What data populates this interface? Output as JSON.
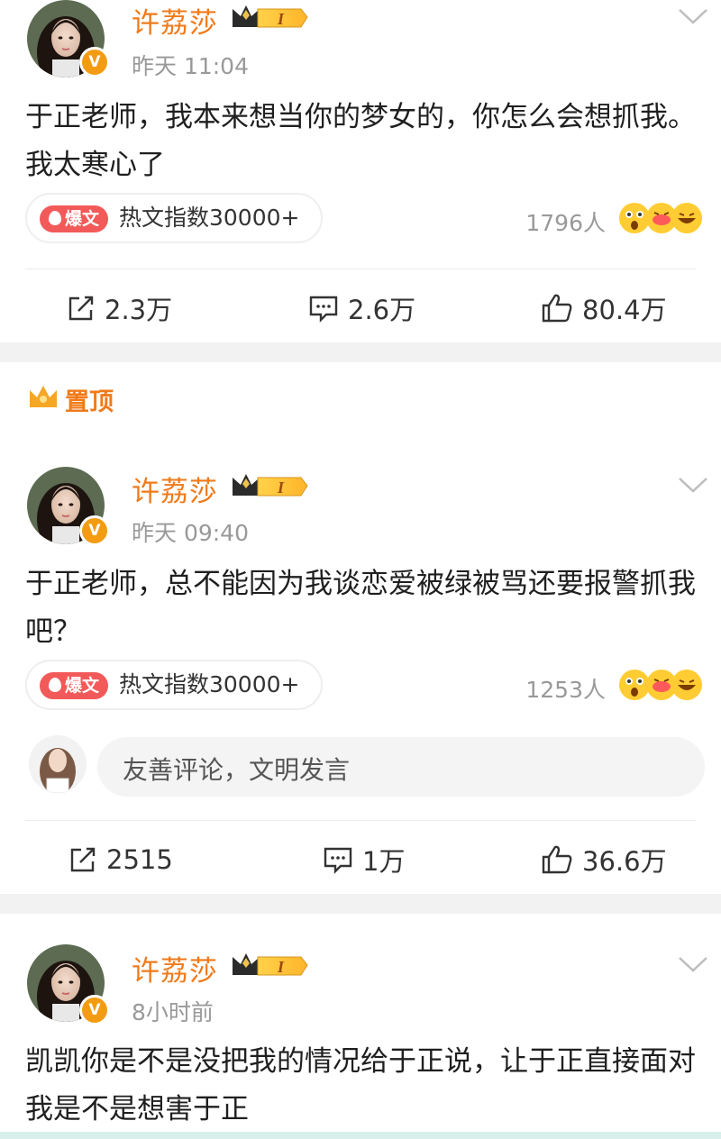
{
  "posts": [
    {
      "username": "许荔莎",
      "vip_level": "I",
      "verified": "V",
      "time": "昨天 11:04",
      "text": "于正老师，我本来想当你的梦女的，你怎么会想抓我。我太寒心了",
      "hot_tag": "爆文",
      "hot_text": "热文指数30000+",
      "people": "1796人",
      "repost": "2.3万",
      "comment": "2.6万",
      "like": "80.4万"
    },
    {
      "pinned_label": "置顶",
      "username": "许荔莎",
      "vip_level": "I",
      "verified": "V",
      "time": "昨天 09:40",
      "text": "于正老师，总不能因为我谈恋爱被绿被骂还要报警抓我吧？",
      "hot_tag": "爆文",
      "hot_text": "热文指数30000+",
      "people": "1253人",
      "comment_placeholder": "友善评论，文明发言",
      "repost": "2515",
      "comment": "1万",
      "like": "36.6万"
    },
    {
      "username": "许荔莎",
      "vip_level": "I",
      "verified": "V",
      "time": "8小时前",
      "text": "凯凯你是不是没把我的情况给于正说，让于正直接面对我是不是想害于正"
    }
  ],
  "colors": {
    "username": "#f07a1a",
    "hot_tag": "#f25a5a",
    "muted": "#999999",
    "section_gap": "#f2f2f2"
  },
  "icons": [
    "chevron-down-icon",
    "repost-icon",
    "comment-icon",
    "like-icon",
    "crown-icon",
    "reaction-emoji-icon"
  ]
}
